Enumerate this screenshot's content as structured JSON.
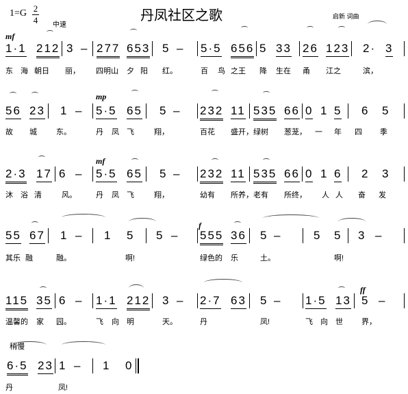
{
  "header": {
    "title": "丹凤社区之歌",
    "key": "1=G",
    "time_top": "2",
    "time_bottom": "4",
    "tempo": "中速",
    "author": "启新  词曲"
  },
  "dynamics": [
    "mf",
    "mp",
    "mf",
    "f",
    "ff",
    "稍慢"
  ],
  "lines": [
    {
      "notes": [
        {
          "n": "1·1",
          "b": 1
        },
        {
          "n": "212",
          "b": 2
        },
        {
          "n": "|"
        },
        {
          "n": "3"
        },
        {
          "n": "–"
        },
        {
          "n": "|"
        },
        {
          "n": "277",
          "b": 2
        },
        {
          "n": "653",
          "b": 2
        },
        {
          "n": "|"
        },
        {
          "n": "5"
        },
        {
          "n": "–"
        },
        {
          "n": "|"
        },
        {
          "n": "5·5",
          "b": 1
        },
        {
          "n": "656",
          "b": 2
        },
        {
          "n": "|"
        },
        {
          "n": "5"
        },
        {
          "n": "33",
          "b": 1
        },
        {
          "n": "|"
        },
        {
          "n": "26",
          "b": 1
        },
        {
          "n": "123",
          "b": 1
        },
        {
          "n": "|"
        },
        {
          "n": "2·"
        },
        {
          "n": "3",
          "b": 1
        },
        {
          "n": "|"
        }
      ],
      "lyrics": [
        "东",
        "海",
        "朝日",
        "丽，",
        "四明山",
        "夕",
        "阳",
        "红。",
        "百",
        "鸟",
        "之王",
        "降",
        "生在",
        "甬",
        "江之",
        "滨，"
      ]
    },
    {
      "notes": [
        {
          "n": "56",
          "b": 1
        },
        {
          "n": "23",
          "b": 1
        },
        {
          "n": "|"
        },
        {
          "n": "1"
        },
        {
          "n": "–"
        },
        {
          "n": "|"
        },
        {
          "n": "5·5",
          "b": 1
        },
        {
          "n": "65",
          "b": 1
        },
        {
          "n": "|"
        },
        {
          "n": "5"
        },
        {
          "n": "–"
        },
        {
          "n": "|"
        },
        {
          "n": "232",
          "b": 2
        },
        {
          "n": "11",
          "b": 1
        },
        {
          "n": "|"
        },
        {
          "n": "535",
          "b": 2
        },
        {
          "n": "66",
          "b": 1
        },
        {
          "n": "|"
        },
        {
          "n": "0",
          "b": 1
        },
        {
          "n": "1"
        },
        {
          "n": "5",
          "b": 1
        },
        {
          "n": "|"
        },
        {
          "n": "6"
        },
        {
          "n": "5"
        },
        {
          "n": "|"
        }
      ],
      "lyrics": [
        "故",
        "城",
        "东。",
        "丹",
        "凤",
        "飞",
        "翔，",
        "百花",
        "盛开，",
        "绿树",
        "葱茏，",
        "一",
        "年",
        "四",
        "季"
      ]
    },
    {
      "notes": [
        {
          "n": "2·3",
          "b": 2
        },
        {
          "n": "17",
          "b": 1
        },
        {
          "n": "|"
        },
        {
          "n": "6"
        },
        {
          "n": "–"
        },
        {
          "n": "|"
        },
        {
          "n": "5·5",
          "b": 1
        },
        {
          "n": "65",
          "b": 1
        },
        {
          "n": "|"
        },
        {
          "n": "5"
        },
        {
          "n": "–"
        },
        {
          "n": "|"
        },
        {
          "n": "232",
          "b": 2
        },
        {
          "n": "11",
          "b": 1
        },
        {
          "n": "|"
        },
        {
          "n": "535",
          "b": 2
        },
        {
          "n": "66",
          "b": 1
        },
        {
          "n": "|"
        },
        {
          "n": "0",
          "b": 1
        },
        {
          "n": "1"
        },
        {
          "n": "6",
          "b": 1
        },
        {
          "n": "|"
        },
        {
          "n": "2"
        },
        {
          "n": "3"
        },
        {
          "n": "|"
        }
      ],
      "lyrics": [
        "沐",
        "浴",
        "清",
        "风。",
        "丹",
        "凤",
        "飞",
        "翔，",
        "幼有",
        "所养，",
        "老有",
        "所终，",
        "人",
        "人",
        "奋",
        "发"
      ]
    },
    {
      "notes": [
        {
          "n": "55",
          "b": 1
        },
        {
          "n": "67",
          "b": 1
        },
        {
          "n": "|"
        },
        {
          "n": "1"
        },
        {
          "n": "–"
        },
        {
          "n": "|"
        },
        {
          "n": "1"
        },
        {
          "n": "5"
        },
        {
          "n": "|"
        },
        {
          "n": "5"
        },
        {
          "n": "–"
        },
        {
          "n": "|"
        },
        {
          "n": "555",
          "b": 2
        },
        {
          "n": "36",
          "b": 1
        },
        {
          "n": "|"
        },
        {
          "n": "5"
        },
        {
          "n": "–"
        },
        {
          "n": "|"
        },
        {
          "n": "5"
        },
        {
          "n": "5"
        },
        {
          "n": "|"
        },
        {
          "n": "3"
        },
        {
          "n": "–"
        },
        {
          "n": "|"
        }
      ],
      "lyrics": [
        "其乐",
        "融",
        "融。",
        "啊!",
        "绿色的",
        "乐",
        "土。",
        "啊!"
      ]
    },
    {
      "notes": [
        {
          "n": "115",
          "b": 2
        },
        {
          "n": "35",
          "b": 1
        },
        {
          "n": "|"
        },
        {
          "n": "6"
        },
        {
          "n": "–"
        },
        {
          "n": "|"
        },
        {
          "n": "1·1",
          "b": 1
        },
        {
          "n": "212",
          "b": 2
        },
        {
          "n": "|"
        },
        {
          "n": "3"
        },
        {
          "n": "–"
        },
        {
          "n": "|"
        },
        {
          "n": "2·7",
          "b": 1
        },
        {
          "n": "63",
          "b": 1
        },
        {
          "n": "|"
        },
        {
          "n": "5"
        },
        {
          "n": "–"
        },
        {
          "n": "|"
        },
        {
          "n": "1·5",
          "b": 1
        },
        {
          "n": "13",
          "b": 1
        },
        {
          "n": "|"
        },
        {
          "n": "5"
        },
        {
          "n": "–"
        },
        {
          "n": "|"
        }
      ],
      "lyrics": [
        "温馨的",
        "家",
        "园。",
        "飞",
        "向",
        "明",
        "天。",
        "丹",
        "凤!",
        "飞",
        "向",
        "世",
        "界，"
      ]
    },
    {
      "notes": [
        {
          "n": "6·5",
          "b": 2
        },
        {
          "n": "23",
          "b": 1
        },
        {
          "n": "|"
        },
        {
          "n": "1"
        },
        {
          "n": "–"
        },
        {
          "n": "|"
        },
        {
          "n": "1"
        },
        {
          "n": "0"
        },
        {
          "n": "‖"
        }
      ],
      "lyrics": [
        "丹",
        "凤!"
      ]
    }
  ]
}
